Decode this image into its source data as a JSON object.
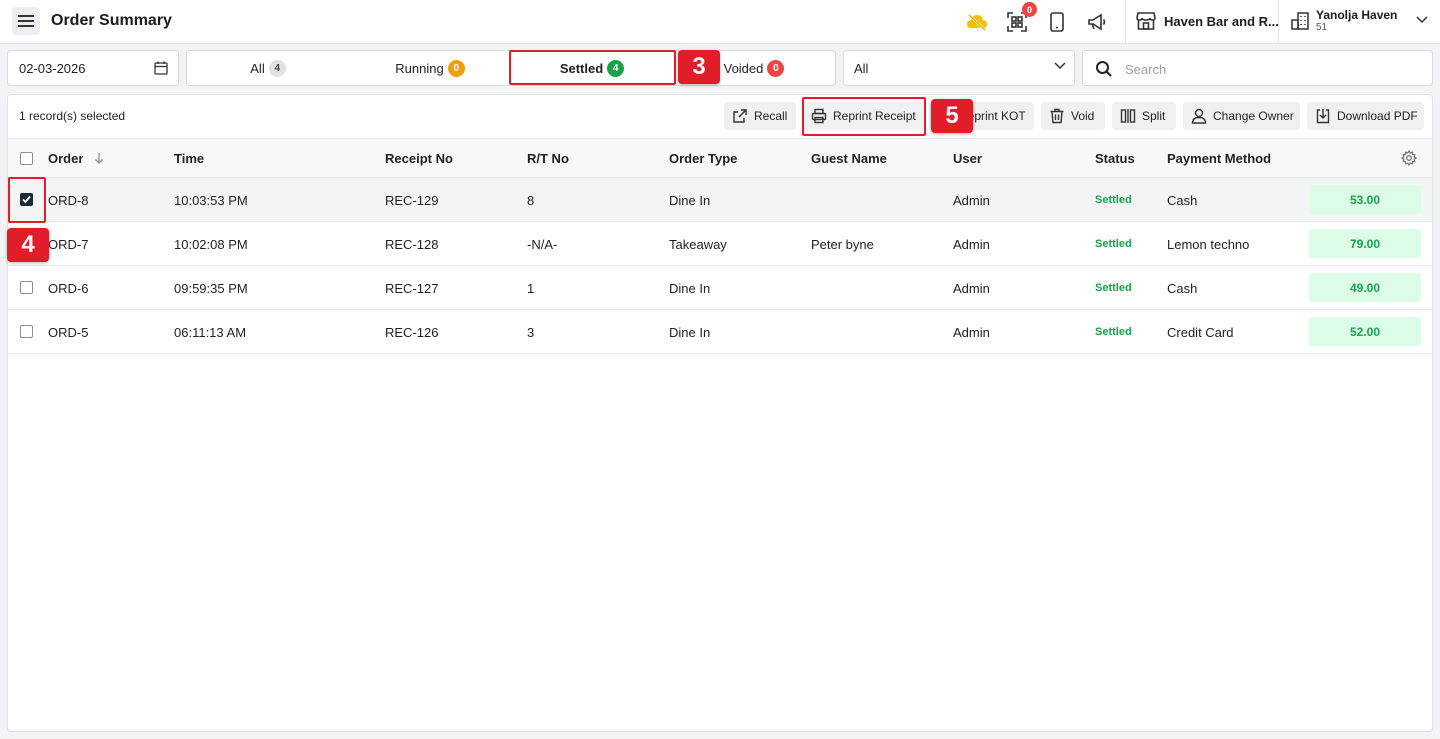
{
  "header": {
    "title": "Order Summary",
    "notification_count": "0",
    "store_name": "Haven Bar and R...",
    "account_name": "Yanolja Haven",
    "account_sub": "51"
  },
  "filters": {
    "date": "02-03-2026",
    "tabs": [
      {
        "label": "All",
        "count": "4"
      },
      {
        "label": "Running",
        "count": "0"
      },
      {
        "label": "Settled",
        "count": "4"
      },
      {
        "label": "Voided",
        "count": "0"
      }
    ],
    "active_tab": "Settled",
    "order_type": "All",
    "search_placeholder": "Search"
  },
  "toolbar": {
    "selected_text": "1 record(s) selected",
    "recall": "Recall",
    "reprint_receipt": "Reprint Receipt",
    "reprint_kot": "Reprint KOT",
    "void": "Void",
    "split": "Split",
    "change_owner": "Change Owner",
    "download_pdf": "Download PDF"
  },
  "table": {
    "columns": [
      "Order",
      "Time",
      "Receipt No",
      "R/T No",
      "Order Type",
      "Guest Name",
      "User",
      "Status",
      "Payment Method"
    ],
    "rows": [
      {
        "order": "ORD-8",
        "time": "10:03:53 PM",
        "receipt": "REC-129",
        "rt": "8",
        "type": "Dine In",
        "guest": "",
        "user": "Admin",
        "status": "Settled",
        "payment": "Cash",
        "amount": "53.00",
        "checked": true
      },
      {
        "order": "ORD-7",
        "time": "10:02:08 PM",
        "receipt": "REC-128",
        "rt": "-N/A-",
        "type": "Takeaway",
        "guest": "Peter byne",
        "user": "Admin",
        "status": "Settled",
        "payment": "Lemon techno",
        "amount": "79.00",
        "checked": false
      },
      {
        "order": "ORD-6",
        "time": "09:59:35 PM",
        "receipt": "REC-127",
        "rt": "1",
        "type": "Dine In",
        "guest": "",
        "user": "Admin",
        "status": "Settled",
        "payment": "Cash",
        "amount": "49.00",
        "checked": false
      },
      {
        "order": "ORD-5",
        "time": "06:11:13 AM",
        "receipt": "REC-126",
        "rt": "3",
        "type": "Dine In",
        "guest": "",
        "user": "Admin",
        "status": "Settled",
        "payment": "Credit Card",
        "amount": "52.00",
        "checked": false
      }
    ]
  },
  "callouts": {
    "step_3": "3",
    "step_4": "4",
    "step_5": "5"
  },
  "colors": {
    "highlight": "#e11d2a",
    "settled_green": "#16a34a",
    "amount_bg": "#dcfce7"
  }
}
